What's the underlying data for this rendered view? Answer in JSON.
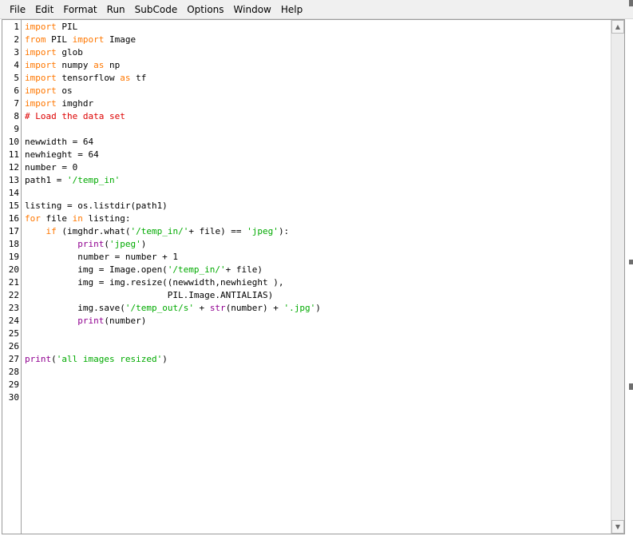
{
  "menu": [
    "File",
    "Edit",
    "Format",
    "Run",
    "SubCode",
    "Options",
    "Window",
    "Help"
  ],
  "line_numbers": [
    "1",
    "2",
    "3",
    "4",
    "5",
    "6",
    "7",
    "8",
    "9",
    "10",
    "11",
    "12",
    "13",
    "14",
    "15",
    "16",
    "17",
    "18",
    "19",
    "20",
    "21",
    "22",
    "23",
    "24",
    "25",
    "26",
    "27",
    "28",
    "29",
    "30"
  ],
  "code_lines": [
    [
      {
        "t": "import",
        "c": "kw"
      },
      {
        "t": " PIL",
        "c": ""
      }
    ],
    [
      {
        "t": "from",
        "c": "kw"
      },
      {
        "t": " PIL ",
        "c": ""
      },
      {
        "t": "import",
        "c": "kw"
      },
      {
        "t": " Image",
        "c": ""
      }
    ],
    [
      {
        "t": "import",
        "c": "kw"
      },
      {
        "t": " glob",
        "c": ""
      }
    ],
    [
      {
        "t": "import",
        "c": "kw"
      },
      {
        "t": " numpy ",
        "c": ""
      },
      {
        "t": "as",
        "c": "kw"
      },
      {
        "t": " np",
        "c": ""
      }
    ],
    [
      {
        "t": "import",
        "c": "kw"
      },
      {
        "t": " tensorflow ",
        "c": ""
      },
      {
        "t": "as",
        "c": "kw"
      },
      {
        "t": " tf",
        "c": ""
      }
    ],
    [
      {
        "t": "import",
        "c": "kw"
      },
      {
        "t": " os",
        "c": ""
      }
    ],
    [
      {
        "t": "import",
        "c": "kw"
      },
      {
        "t": " imghdr",
        "c": ""
      }
    ],
    [
      {
        "t": "# Load the data set",
        "c": "cm"
      }
    ],
    [],
    [
      {
        "t": "newwidth = 64",
        "c": ""
      }
    ],
    [
      {
        "t": "newhieght = 64",
        "c": ""
      }
    ],
    [
      {
        "t": "number = 0",
        "c": ""
      }
    ],
    [
      {
        "t": "path1 = ",
        "c": ""
      },
      {
        "t": "'/temp_in'",
        "c": "str"
      }
    ],
    [],
    [
      {
        "t": "listing = os.listdir(path1)",
        "c": ""
      }
    ],
    [
      {
        "t": "for",
        "c": "kw"
      },
      {
        "t": " file ",
        "c": ""
      },
      {
        "t": "in",
        "c": "kw"
      },
      {
        "t": " listing:",
        "c": ""
      }
    ],
    [
      {
        "t": "    ",
        "c": ""
      },
      {
        "t": "if",
        "c": "kw"
      },
      {
        "t": " (imghdr.what(",
        "c": ""
      },
      {
        "t": "'/temp_in/'",
        "c": "str"
      },
      {
        "t": "+ file) == ",
        "c": ""
      },
      {
        "t": "'jpeg'",
        "c": "str"
      },
      {
        "t": "):",
        "c": ""
      }
    ],
    [
      {
        "t": "          ",
        "c": ""
      },
      {
        "t": "print",
        "c": "bi"
      },
      {
        "t": "(",
        "c": ""
      },
      {
        "t": "'jpeg'",
        "c": "str"
      },
      {
        "t": ")",
        "c": ""
      }
    ],
    [
      {
        "t": "          number = number + 1",
        "c": ""
      }
    ],
    [
      {
        "t": "          img = Image.open(",
        "c": ""
      },
      {
        "t": "'/temp_in/'",
        "c": "str"
      },
      {
        "t": "+ file)",
        "c": ""
      }
    ],
    [
      {
        "t": "          img = img.resize((newwidth,newhieght ),",
        "c": ""
      }
    ],
    [
      {
        "t": "                           PIL.Image.ANTIALIAS)",
        "c": ""
      }
    ],
    [
      {
        "t": "          img.save(",
        "c": ""
      },
      {
        "t": "'/temp_out/s'",
        "c": "str"
      },
      {
        "t": " + ",
        "c": ""
      },
      {
        "t": "str",
        "c": "bi"
      },
      {
        "t": "(number) + ",
        "c": ""
      },
      {
        "t": "'.jpg'",
        "c": "str"
      },
      {
        "t": ")",
        "c": ""
      }
    ],
    [
      {
        "t": "          ",
        "c": ""
      },
      {
        "t": "print",
        "c": "bi"
      },
      {
        "t": "(number)",
        "c": ""
      }
    ],
    [],
    [],
    [
      {
        "t": "print",
        "c": "bi"
      },
      {
        "t": "(",
        "c": ""
      },
      {
        "t": "'all images resized'",
        "c": "str"
      },
      {
        "t": ")",
        "c": ""
      }
    ],
    [],
    [],
    []
  ],
  "colors": {
    "keyword": "#ff7700",
    "builtin": "#900090",
    "string": "#00aa00",
    "comment": "#dd0000"
  },
  "scrollbar": {
    "up_icon": "triangle-up-icon",
    "down_icon": "triangle-down-icon"
  }
}
